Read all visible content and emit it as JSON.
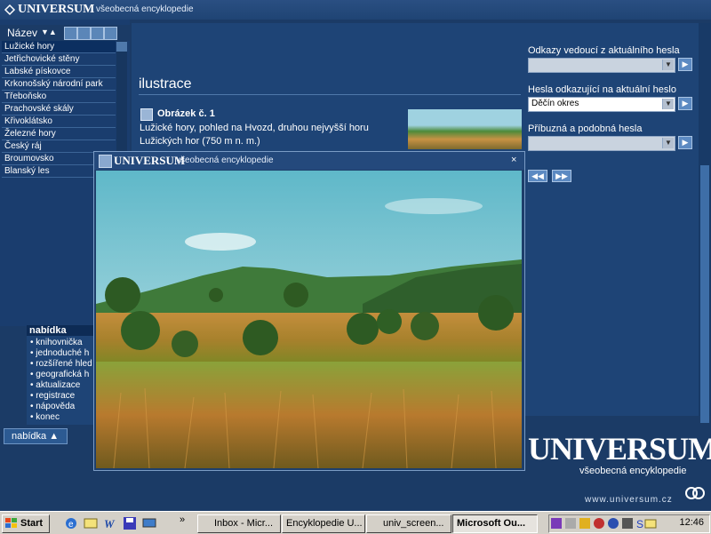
{
  "app": {
    "logo": "UNIVERSUM",
    "subtitle": "všeobecná encyklopedie"
  },
  "left_list": {
    "header_label": "Název",
    "sort_symbol": "▼▲",
    "items": [
      "Lužické hory",
      "Jetřichovické stěny",
      "Labské pískovce",
      "Krkonošský národní park",
      "Třeboňsko",
      "Prachovské skály",
      "Křivoklátsko",
      "Železné hory",
      "Český ráj",
      "Broumovsko",
      "Blanský les"
    ]
  },
  "main": {
    "section_title": "ilustrace",
    "image_title": "Obrázek č. 1",
    "image_description": "Lužické hory, pohled na Hvozd, druhou nejvyšší horu Lužických hor (750 m n. m.)"
  },
  "right_controls": {
    "links_label": "Odkazy vedoucí z aktuálního hesla",
    "links_value": "",
    "backlinks_label": "Hesla odkazující na aktuální heslo",
    "backlinks_value": "Děčín okres",
    "related_label": "Příbuzná a podobná hesla",
    "related_value": ""
  },
  "menu": {
    "title": "nabídka",
    "items": [
      "knihovnička",
      "jednoduché h",
      "rozšířené hled",
      "geografická h",
      "aktualizace",
      "registrace",
      "nápověda",
      "konec"
    ],
    "button_label": "nabídka ▲"
  },
  "branding": {
    "big": "UNIVERSUM",
    "sub": "všeobecná encyklopedie",
    "url": "www.universum.cz"
  },
  "popup": {
    "logo": "UNIVERSUM",
    "subtitle": "všeobecná encyklopedie",
    "close": "×"
  },
  "taskbar": {
    "start": "Start",
    "overflow": "»",
    "buttons": [
      "Inbox - Micr...",
      "Encyklopedie U...",
      "univ_screen...",
      "Microsoft Ou..."
    ],
    "clock": "12:46"
  }
}
